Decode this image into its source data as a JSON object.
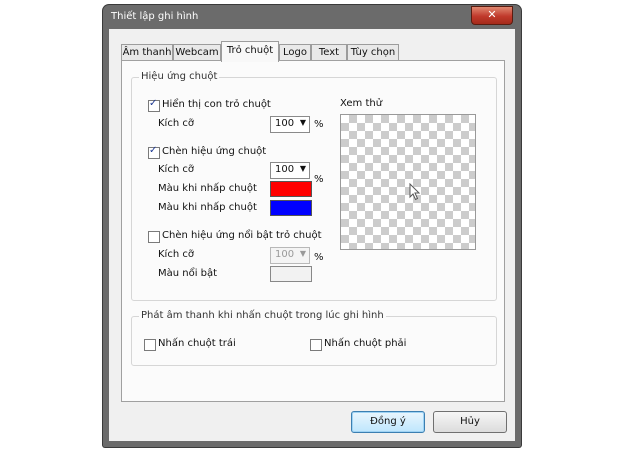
{
  "window": {
    "title": "Thiết lập ghi hình",
    "close_glyph": "✕"
  },
  "tabs": [
    {
      "label": "Âm thanh"
    },
    {
      "label": "Webcam"
    },
    {
      "label": "Trỏ chuột",
      "active": true
    },
    {
      "label": "Logo"
    },
    {
      "label": "Text"
    },
    {
      "label": "Tùy chọn"
    }
  ],
  "mouse_effects": {
    "legend": "Hiệu ứng chuột",
    "show_cursor": {
      "label": "Hiển thị con trỏ chuột",
      "checked": true,
      "size_label": "Kích cỡ",
      "size_value": "100",
      "unit": "%"
    },
    "click_effect": {
      "label": "Chèn hiệu ứng chuột",
      "checked": true,
      "size_label": "Kích cỡ",
      "size_value": "100",
      "unit": "%",
      "left_color_label": "Màu khi nhấp chuột",
      "left_color": "#ff0000",
      "right_color_label": "Màu khi nhấp chuột",
      "right_color": "#0000ff"
    },
    "highlight": {
      "label": "Chèn hiệu ứng nổi bật trỏ chuột",
      "checked": false,
      "size_label": "Kích cỡ",
      "size_value": "100",
      "unit": "%",
      "color_label": "Màu nổi bật",
      "color": "#f2f2f2"
    },
    "preview_label": "Xem thử"
  },
  "sound": {
    "legend": "Phát âm thanh khi nhấn chuột trong lúc ghi hình",
    "left_click": {
      "label": "Nhấn chuột trái",
      "checked": false
    },
    "right_click": {
      "label": "Nhấn chuột phải",
      "checked": false
    }
  },
  "buttons": {
    "ok": "Đồng ý",
    "cancel": "Hủy"
  },
  "icons": {
    "checkmark": "✓",
    "dropdown": "▼"
  }
}
